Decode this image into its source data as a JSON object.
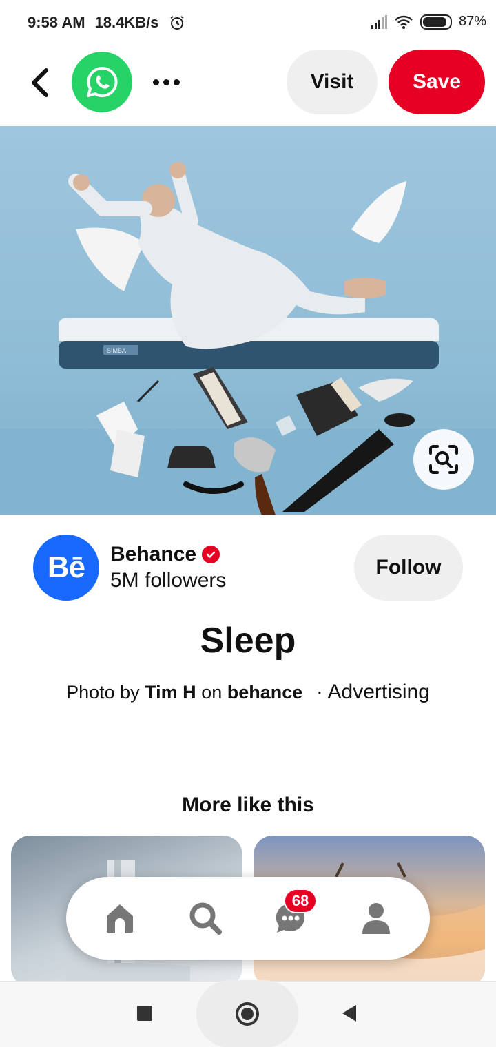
{
  "status_bar": {
    "time": "9:58 AM",
    "network_speed": "18.4KB/s",
    "battery": "87%"
  },
  "topbar": {
    "visit_label": "Visit",
    "save_label": "Save"
  },
  "creator": {
    "avatar_text": "Bē",
    "name": "Behance",
    "followers": "5M followers",
    "follow_label": "Follow"
  },
  "pin": {
    "title": "Sleep",
    "credit_prefix": "Photo by",
    "author": "Tim H",
    "credit_on": "on",
    "source": "behance",
    "category": "· Advertising",
    "image_brand": "SIMBA"
  },
  "more": {
    "title": "More like this"
  },
  "bottom_nav": {
    "badge_count": "68"
  },
  "colors": {
    "brand_red": "#e60023",
    "whatsapp_green": "#25D366",
    "behance_blue": "#1769ff"
  }
}
